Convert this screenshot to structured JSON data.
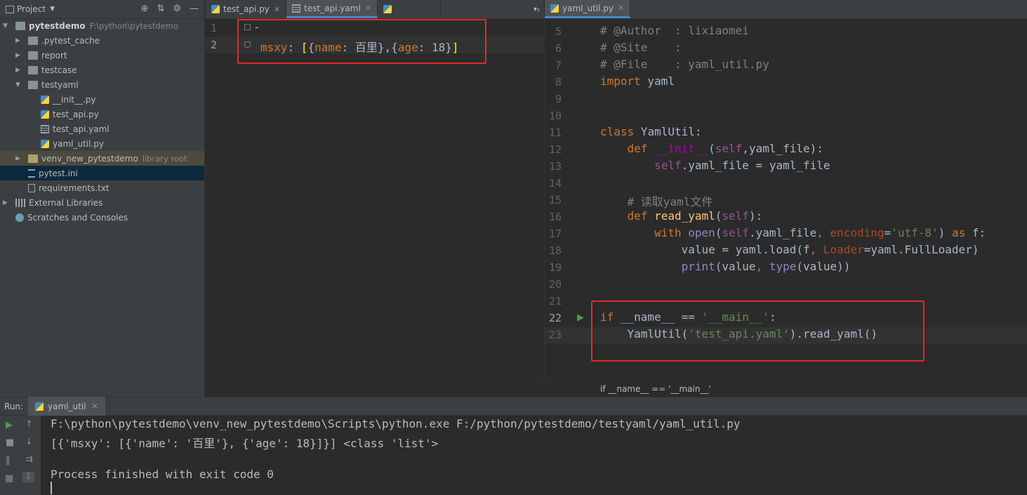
{
  "project_panel": {
    "title": "Project",
    "tree": [
      {
        "label": "pytestdemo",
        "extra": "F:\\python\\pytestdemo"
      },
      {
        "label": ".pytest_cache"
      },
      {
        "label": "report"
      },
      {
        "label": "testcase"
      },
      {
        "label": "testyaml"
      },
      {
        "label": "__init__.py"
      },
      {
        "label": "test_api.py"
      },
      {
        "label": "test_api.yaml"
      },
      {
        "label": "yaml_util.py"
      },
      {
        "label": "venv_new_pytestdemo",
        "extra": "library root"
      },
      {
        "label": "pytest.ini"
      },
      {
        "label": "requirements.txt"
      },
      {
        "label": "External Libraries"
      },
      {
        "label": "Scratches and Consoles"
      }
    ]
  },
  "left_tabs": [
    {
      "label": "test_api.py"
    },
    {
      "label": "test_api.yaml"
    },
    {
      "label": ""
    }
  ],
  "left_tabs_more": "▾₂",
  "right_tabs": [
    {
      "label": "yaml_util.py"
    }
  ],
  "yaml_editor": {
    "line_numbers": [
      "1",
      "2"
    ],
    "line1": "-",
    "line2": {
      "key": "msxy",
      "colon": ": ",
      "open": "[",
      "b1": "{",
      "k1": "name",
      "v1": "百里",
      "b1c": "},",
      "b2": "{",
      "k2": "age",
      "v2": "18",
      "b2c": "}",
      "close": "]"
    }
  },
  "py_editor": {
    "line_numbers": [
      "5",
      "6",
      "7",
      "8",
      "9",
      "10",
      "11",
      "12",
      "13",
      "14",
      "15",
      "16",
      "17",
      "18",
      "19",
      "20",
      "21",
      "22",
      "23"
    ],
    "lines": {
      "l5": "# @Author  : lixiaomei",
      "l6": "# @Site    :",
      "l7": "# @File    : yaml_util.py",
      "l8_kw": "import",
      "l8_rest": " yaml",
      "l11_kw": "class",
      "l11_name": " YamlUtil:",
      "l12_kw": "    def ",
      "l12_fn": "__init__",
      "l12_p1": "(",
      "l12_self": "self",
      "l12_rest": ",yaml_file):",
      "l13_self": "        self",
      "l13_rest": ".yaml_file = yaml_file",
      "l15": "    # 读取yaml文件",
      "l16_kw": "    def ",
      "l16_fn": "read_yaml",
      "l16_p": "(",
      "l16_self": "self",
      "l16_end": "):",
      "l17_kw": "        with ",
      "l17_open": "open",
      "l17_a": "(",
      "l17_self": "self",
      "l17_b": ".yaml_file",
      "l17_c": ", ",
      "l17_param": "encoding",
      "l17_d": "=",
      "l17_str": "'utf-8'",
      "l17_e": ") ",
      "l17_as": "as",
      "l17_f": " f:",
      "l18_a": "            value = yaml.load(f",
      "l18_b": ", ",
      "l18_param": "Loader",
      "l18_c": "=yaml.FullLoader)",
      "l19_print": "            print",
      "l19_a": "(value",
      "l19_b": ", ",
      "l19_type": "type",
      "l19_c": "(value))",
      "l22_kw": "if",
      "l22_a": " __name__ == ",
      "l22_str": "'__main__'",
      "l22_b": ":",
      "l23_a": "    YamlUtil(",
      "l23_str": "'test_api.yaml'",
      "l23_b": ").read_yaml()"
    }
  },
  "breadcrumb": "if __name__ == '__main__'",
  "run_panel": {
    "label": "Run:",
    "tab": "yaml_util",
    "console": [
      "F:\\python\\pytestdemo\\venv_new_pytestdemo\\Scripts\\python.exe F:/python/pytestdemo/testyaml/yaml_util.py",
      "[{'msxy': [{'name': '百里'}, {'age': 18}]}] <class 'list'>",
      "",
      "Process finished with exit code 0"
    ]
  }
}
